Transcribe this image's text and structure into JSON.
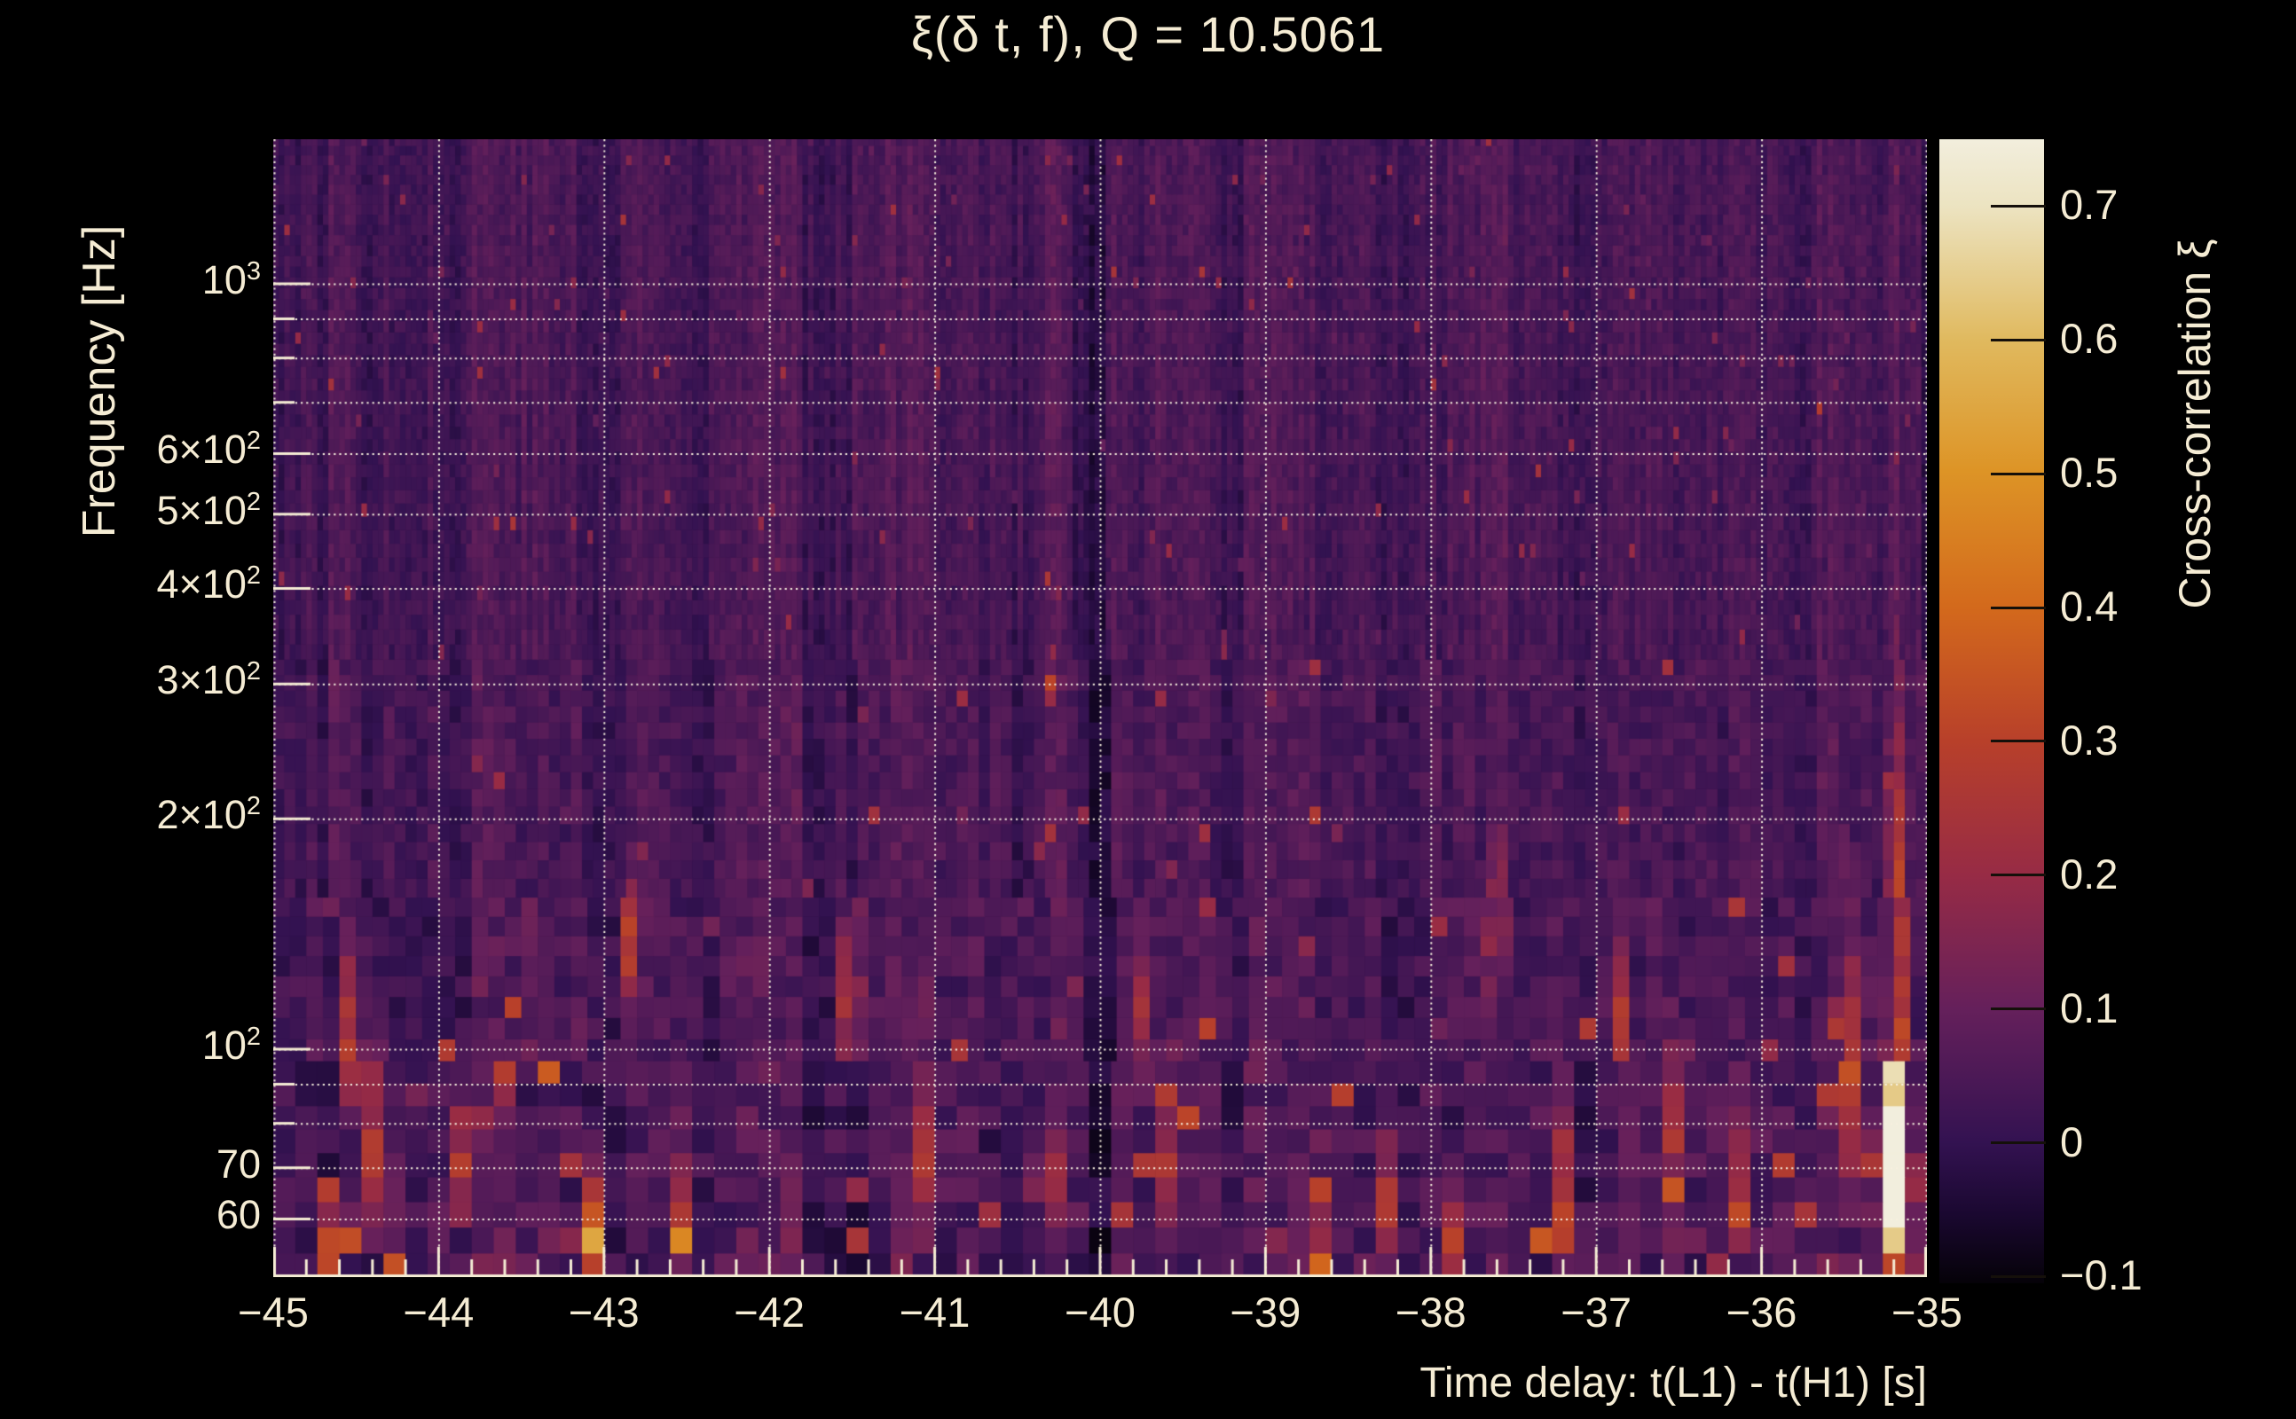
{
  "colors": {
    "background": "#000000",
    "text": "#f5ecd4",
    "grid": "#f7f1df",
    "axis": "#f5ecd4",
    "colorbar_tick": "#15100a"
  },
  "chart_data": {
    "type": "heatmap",
    "title": "ξ(δ t, f), Q = 10.5061",
    "xlabel": "Time delay: t(L1) - t(H1) [s]",
    "ylabel": "Frequency [Hz]",
    "colorbar_label": "Cross-correlation ξ",
    "x_range": [
      -45,
      -35
    ],
    "y_range_hz": [
      50,
      1540
    ],
    "y_scale": "log",
    "x_ticks": [
      {
        "v": -45,
        "label": "−45"
      },
      {
        "v": -44,
        "label": "−44"
      },
      {
        "v": -43,
        "label": "−43"
      },
      {
        "v": -42,
        "label": "−42"
      },
      {
        "v": -41,
        "label": "−41"
      },
      {
        "v": -40,
        "label": "−40"
      },
      {
        "v": -39,
        "label": "−39"
      },
      {
        "v": -38,
        "label": "−38"
      },
      {
        "v": -37,
        "label": "−37"
      },
      {
        "v": -36,
        "label": "−36"
      },
      {
        "v": -35,
        "label": "−35"
      }
    ],
    "x_minor_tick_step": 0.2,
    "y_ticks": [
      {
        "v": 1000,
        "base": "10",
        "exp": "3",
        "labeled": true
      },
      {
        "v": 900,
        "labeled": false
      },
      {
        "v": 800,
        "labeled": false
      },
      {
        "v": 700,
        "labeled": false
      },
      {
        "v": 600,
        "base": "6×10",
        "exp": "2",
        "labeled": true
      },
      {
        "v": 500,
        "base": "5×10",
        "exp": "2",
        "labeled": true
      },
      {
        "v": 400,
        "base": "4×10",
        "exp": "2",
        "labeled": true
      },
      {
        "v": 300,
        "base": "3×10",
        "exp": "2",
        "labeled": true
      },
      {
        "v": 200,
        "base": "2×10",
        "exp": "2",
        "labeled": true
      },
      {
        "v": 100,
        "base": "10",
        "exp": "2",
        "labeled": true
      },
      {
        "v": 90,
        "labeled": false
      },
      {
        "v": 80,
        "labeled": false
      },
      {
        "v": 70,
        "base": "70",
        "labeled": true
      },
      {
        "v": 60,
        "base": "60",
        "labeled": true
      }
    ],
    "grid_freqs": [
      60,
      70,
      80,
      90,
      100,
      200,
      300,
      400,
      500,
      600,
      700,
      800,
      900,
      1000
    ],
    "colorbar": {
      "vmin": -0.105,
      "vmax": 0.75,
      "ticks": [
        {
          "v": 0.7,
          "label": "0.7"
        },
        {
          "v": 0.6,
          "label": "0.6"
        },
        {
          "v": 0.5,
          "label": "0.5"
        },
        {
          "v": 0.4,
          "label": "0.4"
        },
        {
          "v": 0.3,
          "label": "0.3"
        },
        {
          "v": 0.2,
          "label": "0.2"
        },
        {
          "v": 0.1,
          "label": "0.1"
        },
        {
          "v": 0.0,
          "label": "0"
        },
        {
          "v": -0.1,
          "label": "−0.1"
        }
      ],
      "gradient": [
        {
          "p": 0.0,
          "c": "#050208"
        },
        {
          "p": 0.06,
          "c": "#1a0830"
        },
        {
          "p": 0.123,
          "c": "#331251"
        },
        {
          "p": 0.24,
          "c": "#65205b"
        },
        {
          "p": 0.357,
          "c": "#972b45"
        },
        {
          "p": 0.474,
          "c": "#b8402a"
        },
        {
          "p": 0.59,
          "c": "#d3691c"
        },
        {
          "p": 0.71,
          "c": "#dd9426"
        },
        {
          "p": 0.824,
          "c": "#e0b95e"
        },
        {
          "p": 0.94,
          "c": "#ece3c0"
        },
        {
          "p": 1.0,
          "c": "#f2eedd"
        }
      ]
    },
    "tiling": {
      "n_cols": 300,
      "f_start": 50,
      "f_end": 1560,
      "bw_coeff": 0.28,
      "bw_power": 0.69
    },
    "noise": {
      "seed": 77,
      "base": 0.035,
      "col_jitter": 0.028,
      "block_jitter": 0.05,
      "cell_jitter": 0.055,
      "spike_prob": 0.011,
      "spike_mag": 0.13
    },
    "hotspots": [
      {
        "t": -35.19,
        "f_lo": 50,
        "f_peak": 66,
        "f_hi": 420,
        "xi": 0.76,
        "st": 0.03
      },
      {
        "t": -35.19,
        "f_lo": 50,
        "f_peak": 60,
        "f_hi": 95,
        "xi": 0.3,
        "st": 0.09
      },
      {
        "t": -35.47,
        "f_lo": 60,
        "f_peak": 95,
        "f_hi": 200,
        "xi": 0.26,
        "st": 0.035
      },
      {
        "t": -43.07,
        "f_lo": 50,
        "f_peak": 57,
        "f_hi": 80,
        "xi": 0.5,
        "st": 0.045
      },
      {
        "t": -42.49,
        "f_lo": 50,
        "f_peak": 58,
        "f_hi": 95,
        "xi": 0.42,
        "st": 0.035
      },
      {
        "t": -42.86,
        "f_lo": 110,
        "f_peak": 140,
        "f_hi": 190,
        "xi": 0.33,
        "st": 0.03
      },
      {
        "t": -44.38,
        "f_lo": 55,
        "f_peak": 75,
        "f_hi": 125,
        "xi": 0.32,
        "st": 0.045
      },
      {
        "t": -44.68,
        "f_lo": 50,
        "f_peak": 56,
        "f_hi": 72,
        "xi": 0.38,
        "st": 0.03
      },
      {
        "t": -44.53,
        "f_lo": 80,
        "f_peak": 100,
        "f_hi": 160,
        "xi": 0.27,
        "st": 0.035
      },
      {
        "t": -43.55,
        "f_lo": 50,
        "f_peak": 57,
        "f_hi": 70,
        "xi": 0.33,
        "st": 0.03
      },
      {
        "t": -43.85,
        "f_lo": 55,
        "f_peak": 70,
        "f_hi": 110,
        "xi": 0.26,
        "st": 0.04
      },
      {
        "t": -40.33,
        "f_lo": 52,
        "f_peak": 68,
        "f_hi": 102,
        "xi": 0.4,
        "st": 0.04
      },
      {
        "t": -41.52,
        "f_lo": 85,
        "f_peak": 115,
        "f_hi": 170,
        "xi": 0.28,
        "st": 0.04
      },
      {
        "t": -41.05,
        "f_lo": 55,
        "f_peak": 70,
        "f_hi": 100,
        "xi": 0.25,
        "st": 0.05
      },
      {
        "t": -39.73,
        "f_lo": 85,
        "f_peak": 115,
        "f_hi": 160,
        "xi": 0.26,
        "st": 0.035
      },
      {
        "t": -39.56,
        "f_lo": 55,
        "f_peak": 70,
        "f_hi": 115,
        "xi": 0.3,
        "st": 0.035
      },
      {
        "t": -38.62,
        "f_lo": 50,
        "f_peak": 58,
        "f_hi": 78,
        "xi": 0.3,
        "st": 0.03
      },
      {
        "t": -38.28,
        "f_lo": 50,
        "f_peak": 60,
        "f_hi": 100,
        "xi": 0.3,
        "st": 0.03
      },
      {
        "t": -37.85,
        "f_lo": 50,
        "f_peak": 56,
        "f_hi": 70,
        "xi": 0.33,
        "st": 0.028
      },
      {
        "t": -37.6,
        "f_lo": 115,
        "f_peak": 145,
        "f_hi": 220,
        "xi": 0.3,
        "st": 0.03
      },
      {
        "t": -37.17,
        "f_lo": 50,
        "f_peak": 62,
        "f_hi": 105,
        "xi": 0.47,
        "st": 0.033
      },
      {
        "t": -36.87,
        "f_lo": 85,
        "f_peak": 110,
        "f_hi": 160,
        "xi": 0.33,
        "st": 0.028
      },
      {
        "t": -36.55,
        "f_lo": 55,
        "f_peak": 75,
        "f_hi": 130,
        "xi": 0.22,
        "st": 0.05
      },
      {
        "t": -36.12,
        "f_lo": 52,
        "f_peak": 64,
        "f_hi": 92,
        "xi": 0.28,
        "st": 0.03
      }
    ]
  }
}
